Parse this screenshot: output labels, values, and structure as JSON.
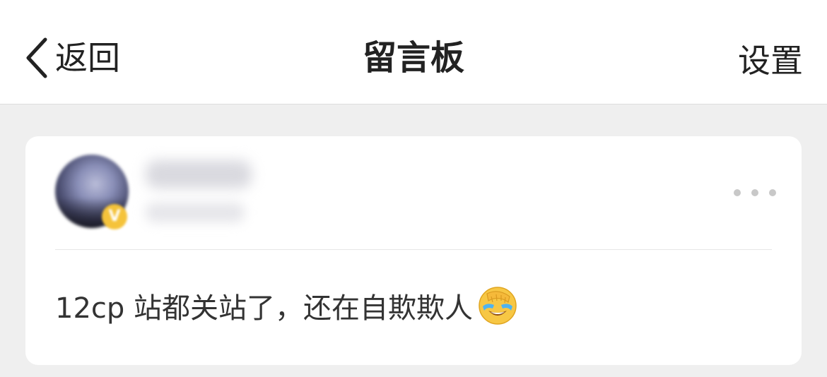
{
  "navbar": {
    "back_label": "返回",
    "title": "留言板",
    "settings_label": "设置"
  },
  "icons": {
    "back": "chevron-left-icon",
    "more": "more-horizontal-icon",
    "emoji": "facepalm-laugh-emoji"
  },
  "comment": {
    "badge": "V",
    "text": "12cp 站都关站了，还在自欺欺人"
  },
  "colors": {
    "page_background": "#efefef",
    "card_background": "#ffffff",
    "text_primary": "#222222",
    "badge": "#f5c33b",
    "more_dots": "#c8c8c8"
  }
}
